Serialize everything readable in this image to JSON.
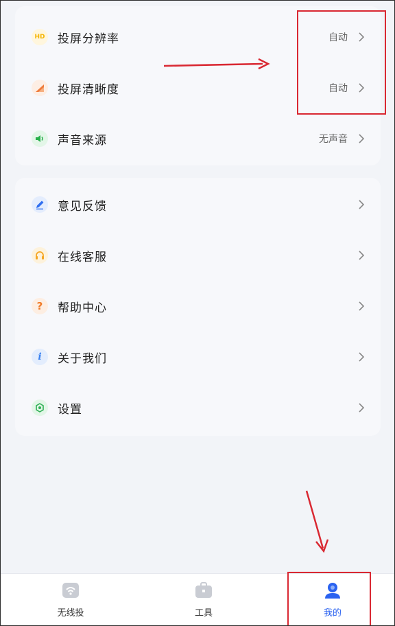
{
  "settings_group": {
    "items": [
      {
        "label": "投屏分辨率",
        "value": "自动",
        "icon": "hd-icon"
      },
      {
        "label": "投屏清晰度",
        "value": "自动",
        "icon": "clarity-icon"
      },
      {
        "label": "声音来源",
        "value": "无声音",
        "icon": "speaker-icon"
      }
    ]
  },
  "support_group": {
    "items": [
      {
        "label": "意见反馈",
        "icon": "pen-icon"
      },
      {
        "label": "在线客服",
        "icon": "headset-icon"
      },
      {
        "label": "帮助中心",
        "icon": "question-icon"
      },
      {
        "label": "关于我们",
        "icon": "info-icon"
      },
      {
        "label": "设置",
        "icon": "settings-icon"
      }
    ]
  },
  "icon_text": {
    "hd": "HD",
    "question": "?",
    "info": "i"
  },
  "tabbar": {
    "tabs": [
      {
        "label": "无线投",
        "icon": "wifi-cast-icon"
      },
      {
        "label": "工具",
        "icon": "toolbox-icon"
      },
      {
        "label": "我的",
        "icon": "user-icon",
        "active": true
      }
    ]
  },
  "colors": {
    "accent": "#2a62f0",
    "annotation": "#d92832",
    "hd_icon": "#f5b400",
    "clarity_icon": "#ef7b3b",
    "speaker_icon": "#27b04a",
    "pen_icon": "#2f6ff0",
    "headset_icon": "#f5a623",
    "question_icon": "#f07a26",
    "info_icon": "#3b82f0",
    "settings_icon": "#2fb055"
  }
}
